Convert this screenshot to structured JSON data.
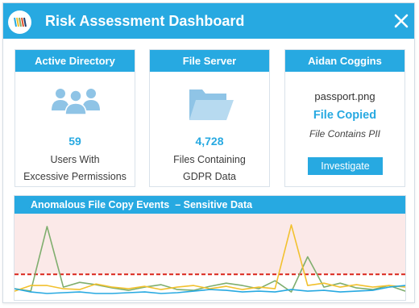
{
  "window": {
    "title": "Risk Assessment Dashboard",
    "logo_icon": "company-logo-icon",
    "close_icon": "close-icon"
  },
  "colors": {
    "accent": "#27a9e1",
    "icon_blue": "#8fc4e6",
    "threshold": "#d9251b",
    "chart_band": "#fbe9e8",
    "series_green": "#7fae6e",
    "series_yellow": "#f2c12e",
    "series_blue": "#27a9e1"
  },
  "cards": {
    "active_directory": {
      "header": "Active Directory",
      "icon": "users-group-icon",
      "value": "59",
      "desc_line1": "Users With",
      "desc_line2": "Excessive Permissions"
    },
    "file_server": {
      "header": "File Server",
      "icon": "folder-icon",
      "value": "4,728",
      "desc_line1": "Files Containing",
      "desc_line2": "GDPR Data"
    },
    "user_alert": {
      "header": "Aidan Coggins",
      "file_name": "passport.png",
      "status": "File Copied",
      "note": "File Contains PII",
      "button_label": "Investigate"
    }
  },
  "chart": {
    "title": "Anomalous File Copy Events  – Sensitive Data"
  },
  "chart_data": {
    "type": "line",
    "title": "Anomalous File Copy Events  – Sensitive Data",
    "xlabel": "",
    "ylabel": "",
    "x": [
      0,
      1,
      2,
      3,
      4,
      5,
      6,
      7,
      8,
      9,
      10,
      11,
      12,
      13,
      14,
      15,
      16,
      17,
      18,
      19,
      20,
      21,
      22,
      23,
      24
    ],
    "ylim": [
      0,
      100
    ],
    "grid": false,
    "threshold": 28,
    "series": [
      {
        "values": [
          10,
          7,
          88,
          12,
          18,
          15,
          11,
          8,
          12,
          15,
          9,
          8,
          13,
          17,
          14,
          10,
          20,
          6,
          50,
          12,
          17,
          11,
          9,
          14,
          7
        ],
        "color": "#7fae6e"
      },
      {
        "values": [
          7,
          14,
          14,
          10,
          9,
          16,
          12,
          10,
          13,
          9,
          12,
          14,
          10,
          13,
          9,
          12,
          10,
          90,
          14,
          17,
          12,
          15,
          12,
          14,
          12
        ],
        "color": "#f2c12e"
      },
      {
        "values": [
          10,
          6,
          4,
          5,
          6,
          4,
          4,
          5,
          6,
          4,
          5,
          7,
          9,
          8,
          6,
          7,
          6,
          9,
          7,
          8,
          6,
          7,
          8,
          12,
          14
        ],
        "color": "#27a9e1"
      }
    ]
  }
}
